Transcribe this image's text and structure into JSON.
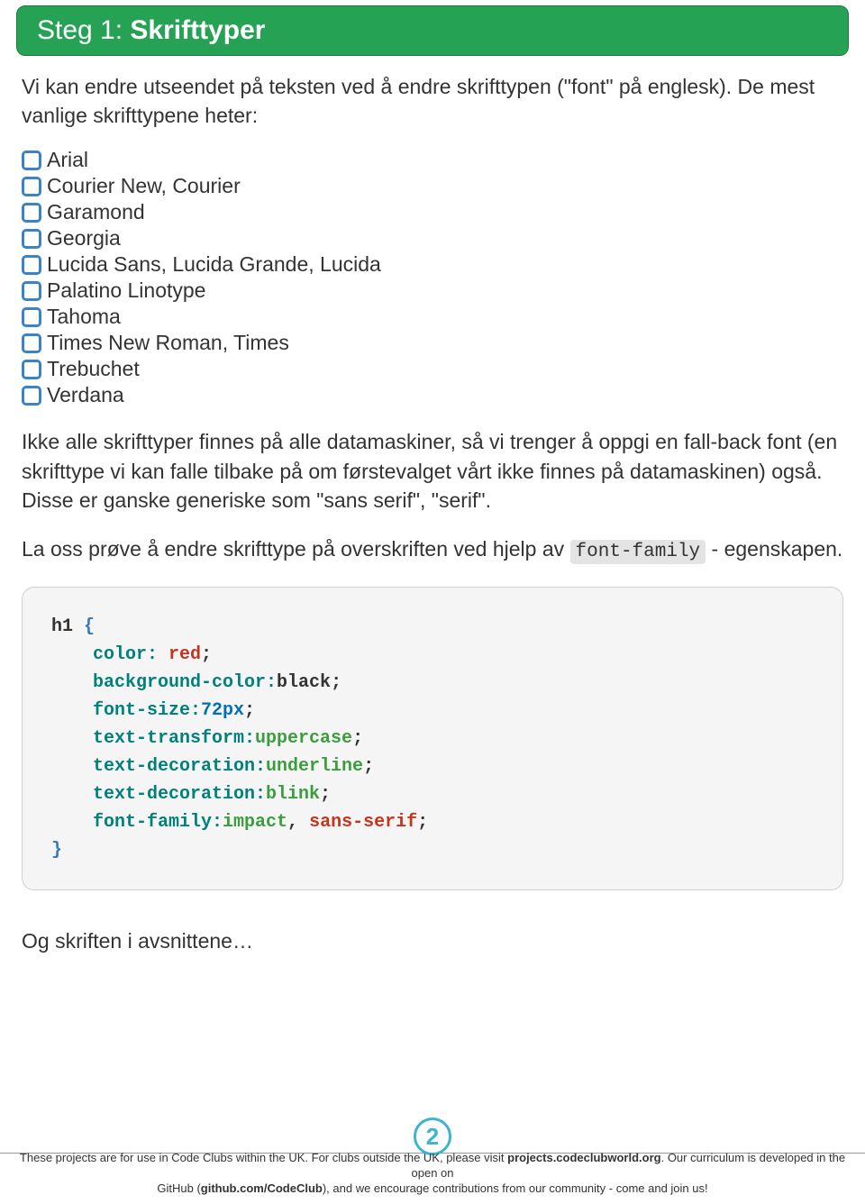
{
  "header": {
    "step_prefix": "Steg 1: ",
    "title": "Skrifttyper"
  },
  "intro": "Vi kan endre utseendet på teksten ved å endre skrifttypen (\"font\" på englesk). De mest vanlige skrifttypene heter:",
  "fonts": [
    "Arial",
    "Courier New, Courier",
    "Garamond",
    "Georgia",
    "Lucida Sans, Lucida Grande, Lucida",
    "Palatino Linotype",
    "Tahoma",
    "Times New Roman, Times",
    "Trebuchet",
    "Verdana"
  ],
  "para1": "Ikke alle skrifttyper finnes på alle datamaskiner, så vi trenger å oppgi en fall-back font (en skrifttype vi kan falle tilbake på om førstevalget vårt ikke finnes på datamaskinen) også. Disse er ganske generiske som \"sans serif\", \"serif\".",
  "para2_prefix": "La oss prøve å endre skrifttype på overskriften ved hjelp av ",
  "para2_code": "font-family",
  "para2_suffix": " - egenskapen.",
  "code": {
    "selector": "h1",
    "open": "{",
    "lines": [
      {
        "prop": "color:",
        "space": " ",
        "val": "red",
        "val_class": "val-red",
        "suffix": ";"
      },
      {
        "prop": "background-color:",
        "space": "",
        "val": "black",
        "val_class": "val-black",
        "suffix": ";"
      },
      {
        "prop": "font-size:",
        "space": "",
        "val": "72px",
        "val_class": "val-blue",
        "suffix": ";"
      },
      {
        "prop": "text-transform:",
        "space": "",
        "val": "uppercase",
        "val_class": "val-green",
        "suffix": ";"
      },
      {
        "prop": "text-decoration:",
        "space": "",
        "val": "underline",
        "val_class": "val-green",
        "suffix": ";"
      },
      {
        "prop": "text-decoration:",
        "space": "",
        "val": "blink",
        "val_class": "val-green",
        "suffix": ";"
      },
      {
        "prop": "font-family:",
        "space": "",
        "val": "impact",
        "val_class": "val-green",
        "suffix": ",",
        "val2": " sans-serif",
        "val2_class": "val-sans",
        "suffix2": ";"
      }
    ],
    "close": "}"
  },
  "para3": "Og skriften i avsnittene…",
  "page_number": "2",
  "footer": {
    "line1a": "These projects are for use in Code Clubs within the UK. For clubs outside the UK, please visit ",
    "line1b": "projects.codeclubworld.org",
    "line1c": ". Our curriculum is developed in the open on",
    "line2a": "GitHub (",
    "line2b": "github.com/CodeClub",
    "line2c": "), and we encourage contributions from our community - come and join us!"
  }
}
